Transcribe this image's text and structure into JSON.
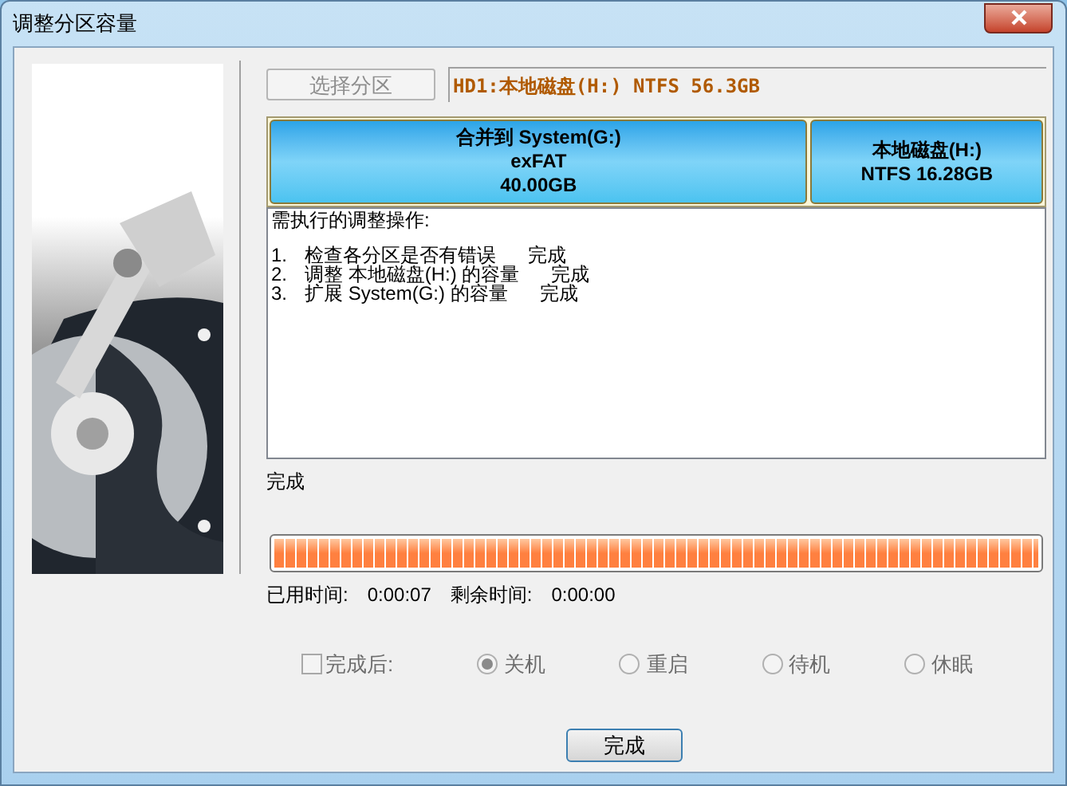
{
  "window": {
    "title": "调整分区容量"
  },
  "select_button": {
    "label": "选择分区",
    "disabled": true
  },
  "disk_field": {
    "value": "HD1:本地磁盘(H:) NTFS 56.3GB"
  },
  "partitions": [
    {
      "lines": [
        "合并到 System(G:)",
        "exFAT",
        "40.00GB"
      ]
    },
    {
      "lines": [
        "本地磁盘(H:)",
        "NTFS 16.28GB"
      ]
    }
  ],
  "log": {
    "heading": "需执行的调整操作:",
    "steps": [
      {
        "number": "1.",
        "text": "检查各分区是否有错误",
        "status": "完成"
      },
      {
        "number": "2.",
        "text": "调整 本地磁盘(H:) 的容量",
        "status": "完成"
      },
      {
        "number": "3.",
        "text": "扩展 System(G:) 的容量",
        "status": "完成"
      }
    ]
  },
  "status": "完成",
  "progress": {
    "level": 1
  },
  "elapsed": {
    "label": "已用时间:",
    "value": "0:00:07"
  },
  "remaining": {
    "label": "剩余时间:",
    "value": "0:00:00"
  },
  "after_finish": {
    "label": "完成后:",
    "checked": false,
    "disabled": true
  },
  "options": [
    {
      "label": "关机",
      "selected": true
    },
    {
      "label": "重启",
      "selected": false
    },
    {
      "label": "待机",
      "selected": false
    },
    {
      "label": "休眠",
      "selected": false
    }
  ],
  "finish_button": {
    "label": "完成"
  }
}
